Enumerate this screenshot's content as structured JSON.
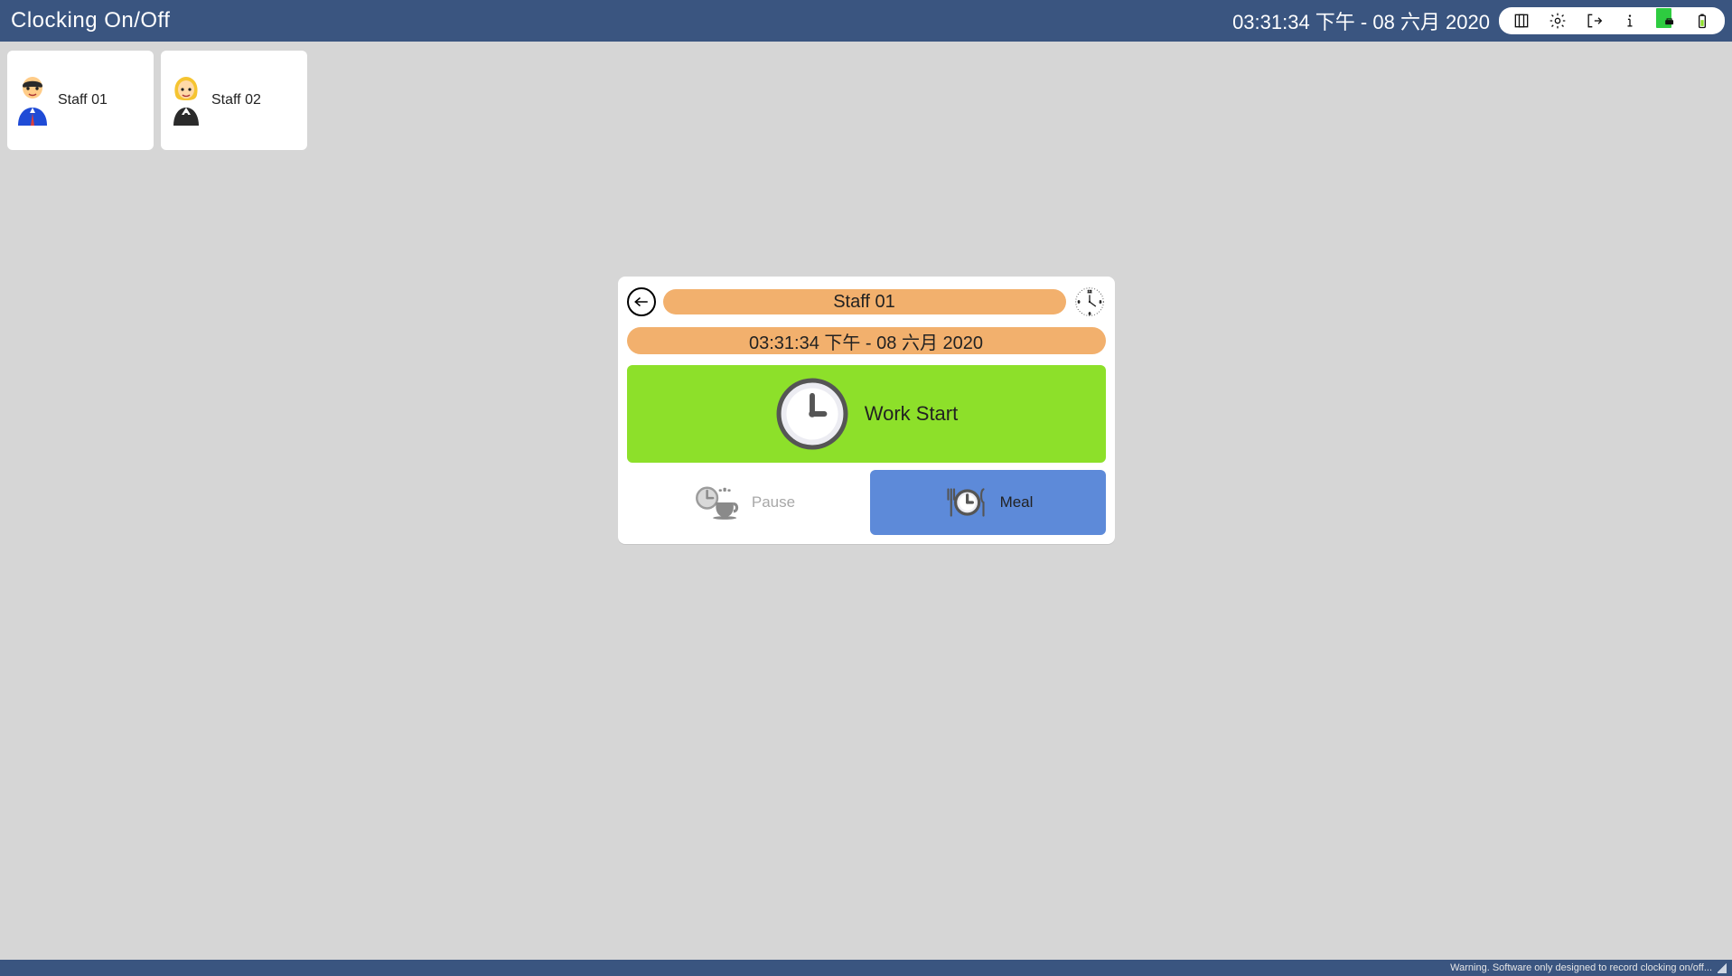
{
  "topbar": {
    "title": "Clocking On/Off",
    "datetime": "03:31:34 下午 - 08 六月 2020",
    "icons": [
      "app-menu-icon",
      "gear-icon",
      "logout-icon",
      "info-icon",
      "network-icon",
      "battery-icon"
    ]
  },
  "staff": [
    {
      "name": "Staff 01"
    },
    {
      "name": "Staff 02"
    }
  ],
  "modal": {
    "staff_name": "Staff 01",
    "datetime": "03:31:34 下午 - 08 六月 2020",
    "work_start_label": "Work Start",
    "pause_label": "Pause",
    "meal_label": "Meal"
  },
  "bottombar": {
    "warning": "Warning. Software only designed to record clocking on/off..."
  }
}
